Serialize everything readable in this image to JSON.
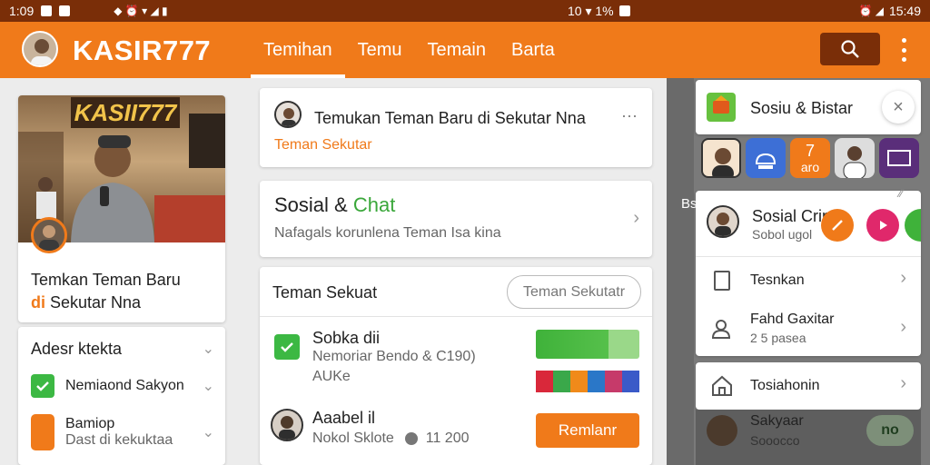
{
  "status": {
    "time_left": "1:09",
    "signal_mid": "10 ▾ 1%",
    "time_right": "15:49"
  },
  "appbar": {
    "brand": "KASIR777",
    "tabs": [
      "Temihan",
      "Temu",
      "Temain",
      "Barta"
    ],
    "active_tab": 0
  },
  "left": {
    "photo_sign": "KASII777",
    "card_title_1": "Temkan Teman Baru",
    "card_title_hl": "di",
    "card_title_2": "Sekutar Nna",
    "list_header": "Adesr ktekta",
    "items": [
      {
        "title": "Nemiaond Sakyon"
      },
      {
        "title": "Bamiop",
        "subtitle": "Dast di kekuktaa"
      }
    ]
  },
  "center": {
    "post": {
      "title": "Temukan Teman Baru di Sekutar Nna",
      "subtitle": "Teman Sekutar"
    },
    "social": {
      "title_1": "Sosial &",
      "title_2": "Chat",
      "subtitle": "Nafagals korunlena Teman Isa kina"
    },
    "friends": {
      "header": "Teman Sekuat",
      "button": "Teman Sekutatr",
      "rows": [
        {
          "name": "Sobka dii",
          "line2": "Nemoriar Bendo & C190)",
          "line3": "AUKe"
        },
        {
          "name": "Aaabel il",
          "line2": "Nokol Sklote",
          "line3": "11 200",
          "action": "Remlanr"
        }
      ]
    }
  },
  "right": {
    "top": {
      "title": "Sosiu & Bistar"
    },
    "chip_text": "aro",
    "chip_num": "7",
    "side_label": "Bs",
    "menu": {
      "profile": {
        "name": "Sosial Crin",
        "sub": "Sobol ugol"
      },
      "items": [
        {
          "label": "Tesnkan"
        },
        {
          "label": "Fahd Gaxitar",
          "sub": "2 5 pasea"
        }
      ]
    },
    "setting": {
      "label": "Tosiahonin"
    },
    "bottom_name": "Sakyaar",
    "bottom_sub": "Sooocco",
    "bottom_badge": "no"
  }
}
